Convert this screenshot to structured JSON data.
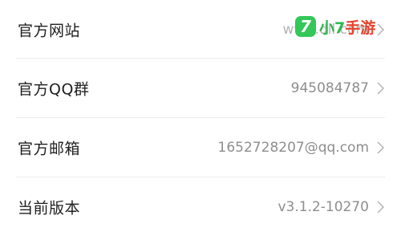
{
  "settings": {
    "rows": [
      {
        "label": "官方网站",
        "value": "www.dll.com"
      },
      {
        "label": "官方QQ群",
        "value": "945084787"
      },
      {
        "label": "官方邮箱",
        "value": "1652728207@qq.com"
      },
      {
        "label": "当前版本",
        "value": "v3.1.2-10270"
      }
    ]
  },
  "watermark": {
    "badge": "7",
    "text_green": "小7",
    "text_red": "手游"
  },
  "colors": {
    "label": "#1f1f1f",
    "value": "#8e8e8e",
    "divider": "#ececec",
    "logo_green": "#2fb94f",
    "logo_red": "#e8432c"
  }
}
